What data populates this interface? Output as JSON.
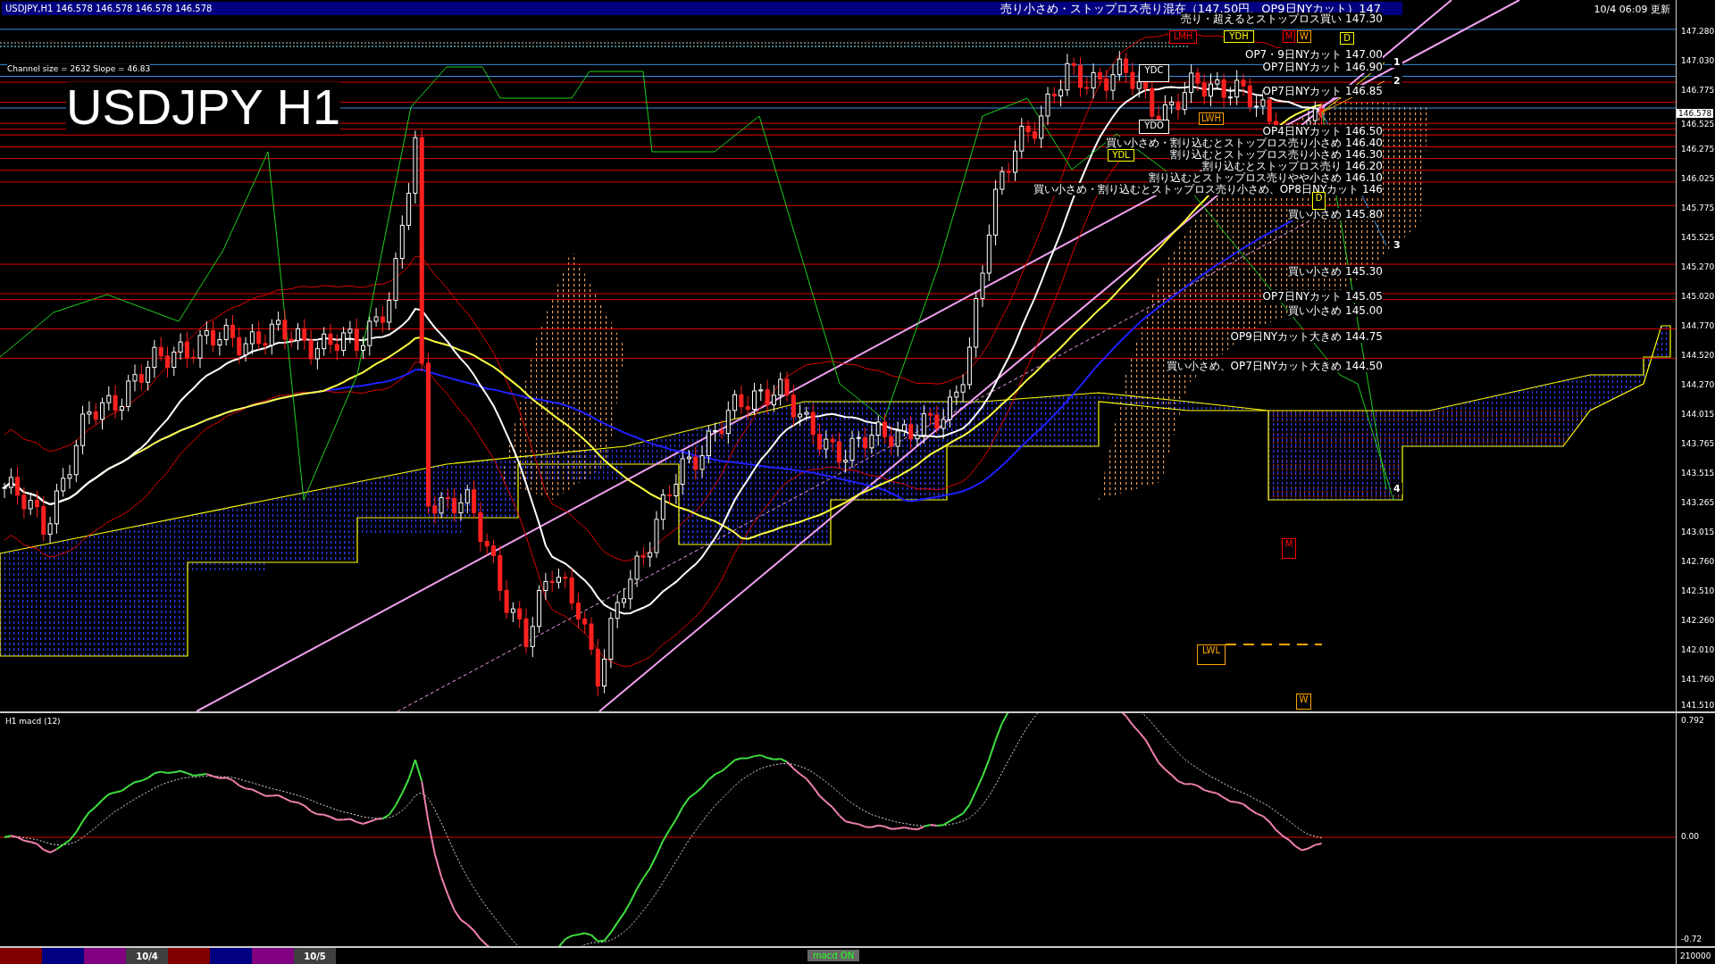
{
  "title_bar": {
    "quote": "USDJPY,H1  146.578 146.578 146.578 146.578",
    "headline": "売り小さめ・ストップロス売り混在（147.50円、OP9日NYカット）147"
  },
  "update_time": "10/4 06:09 更新",
  "channel_info": "Channel size = 2632 Slope = 46.83",
  "chart_title": "USDJPY H1",
  "annotations": [
    {
      "text": "売り・超えるとストップロス買い 147.30"
    },
    {
      "text": "OP7・9日NYカット 147.00"
    },
    {
      "text": "OP7日NYカット 146.90"
    },
    {
      "text": "OP7日NYカット 146.85"
    },
    {
      "text": "OP4日NYカット 146.50"
    },
    {
      "text": "買い小さめ・割り込むとストップロス売り小さめ 146.40"
    },
    {
      "text": "割り込むとストップロス売り小さめ 146.30"
    },
    {
      "text": "割り込むとストップロス売り 146.20"
    },
    {
      "text": "割り込むとストップロス売りやや小さめ 146.10"
    },
    {
      "text": "買い小さめ・割り込むとストップロス売り小さめ、OP8日NYカット 146"
    },
    {
      "text": "買い小さめ 145.80"
    },
    {
      "text": "買い小さめ 145.30"
    },
    {
      "text": "OP7日NYカット 145.05"
    },
    {
      "text": "買い小さめ 145.00"
    },
    {
      "text": "OP9日NYカット大きめ 144.75"
    },
    {
      "text": "買い小さめ、OP7日NYカット大きめ 144.50"
    }
  ],
  "markers": [
    {
      "label": "LMH",
      "color": "#ff0000"
    },
    {
      "label": "YDH",
      "color": "#ffff00"
    },
    {
      "label": "M",
      "color": "#ff0000"
    },
    {
      "label": "W",
      "color": "#ffa500"
    },
    {
      "label": "YDC",
      "color": "#ffffff"
    },
    {
      "label": "D",
      "color": "#ffff00"
    },
    {
      "label": "LWH",
      "color": "#ffa500"
    },
    {
      "label": "YDO",
      "color": "#ffffff"
    },
    {
      "label": "YDL",
      "color": "#ffff00"
    },
    {
      "label": "D",
      "color": "#ffff00"
    },
    {
      "label": "M",
      "color": "#ff0000"
    },
    {
      "label": "LWL",
      "color": "#ffa500"
    },
    {
      "label": "W",
      "color": "#ffa500"
    }
  ],
  "line_numbers": [
    "1",
    "2",
    "3",
    "4"
  ],
  "price_axis": [
    "147.280",
    "147.030",
    "146.775",
    "146.525",
    "146.275",
    "146.025",
    "145.775",
    "145.525",
    "145.270",
    "145.020",
    "144.770",
    "144.520",
    "144.270",
    "144.015",
    "143.765",
    "143.515",
    "143.265",
    "143.015",
    "142.760",
    "142.510",
    "142.260",
    "142.010",
    "141.760",
    "141.510"
  ],
  "current_price": "146.578",
  "macd_panel": {
    "label": "H1  macd (12)",
    "axis": [
      "0.792",
      "0.00",
      "-0.72"
    ],
    "volume_label": "210000"
  },
  "session_bar": [
    {
      "color": "#800000"
    },
    {
      "color": "#000080"
    },
    {
      "color": "#800080"
    },
    {
      "color": "#404040",
      "label": "10/4"
    },
    {
      "color": "#800000"
    },
    {
      "color": "#000080"
    },
    {
      "color": "#800080"
    },
    {
      "color": "#404040",
      "label": "10/5"
    }
  ],
  "indicator_badge": "macd ON"
}
